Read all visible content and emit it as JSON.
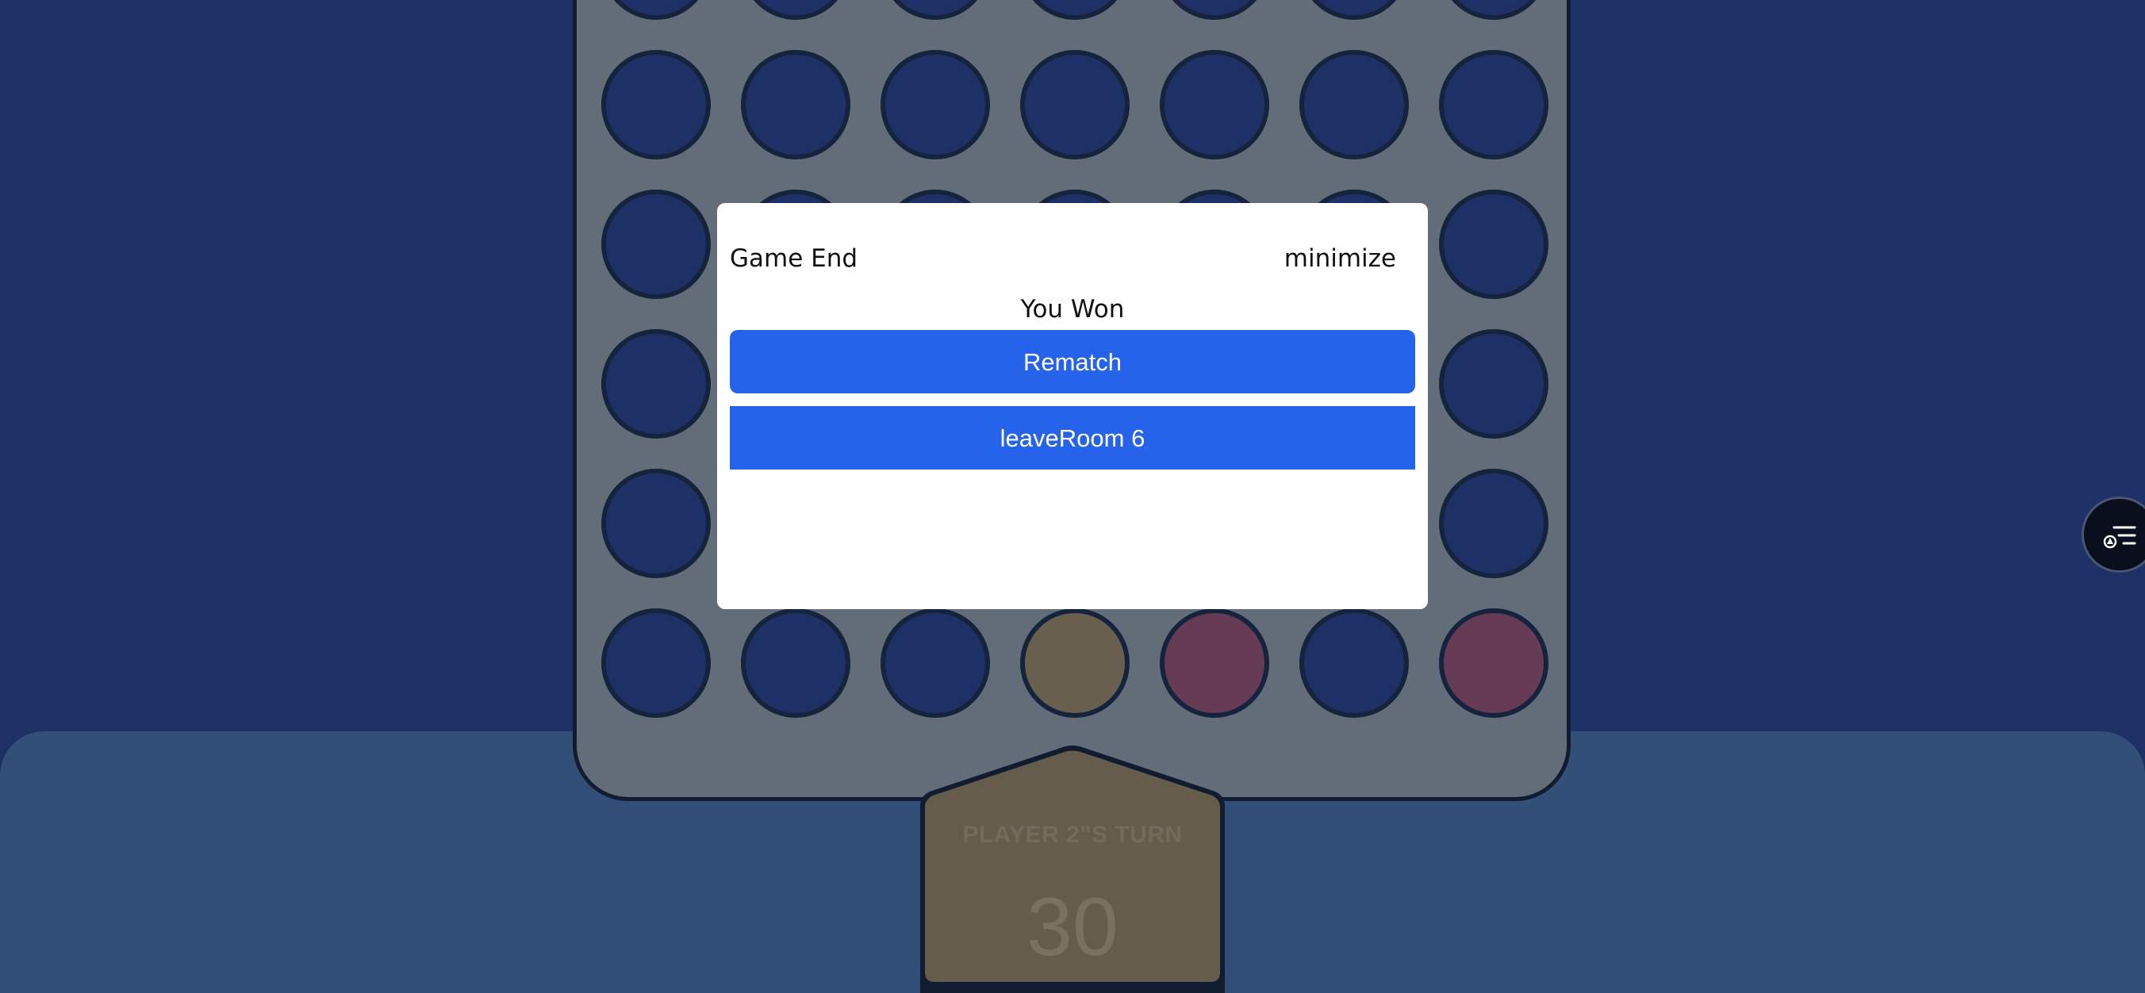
{
  "board": {
    "rows": 6,
    "columns": 7,
    "visible_bottom_row": [
      "empty",
      "empty",
      "empty",
      "yellow",
      "red",
      "empty",
      "red"
    ],
    "colors": {
      "background": "#1e3166",
      "board": "#636c79",
      "hole": "#1e3166",
      "yellow_piece": "#695f4f",
      "red_piece": "#663b55",
      "bottom_panel": "#325077"
    }
  },
  "turn_indicator": {
    "label": "PLAYER 2\"S TURN",
    "timer": "30"
  },
  "modal": {
    "title": "Game End",
    "minimize_label": "minimize",
    "message": "You Won",
    "rematch_label": "Rematch",
    "leave_label": "leaveRoom 6",
    "accent_color": "#2563eb"
  },
  "side_button": {
    "icon": "menu-list-icon"
  }
}
